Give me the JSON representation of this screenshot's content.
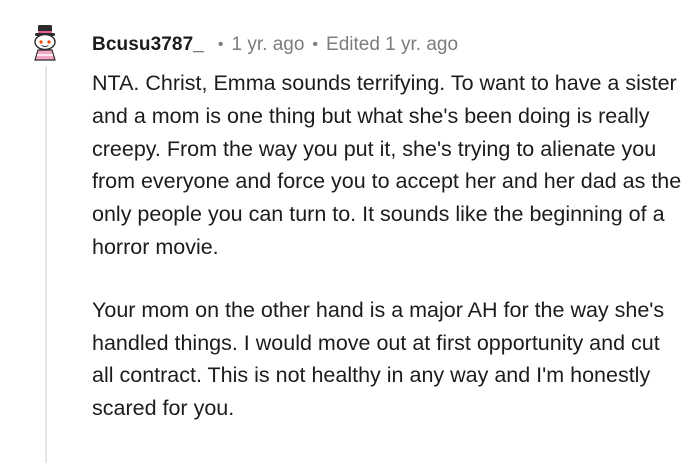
{
  "comment": {
    "username": "Bcusu3787_",
    "timestamp": "1 yr. ago",
    "edited": "Edited 1 yr. ago",
    "paragraphs": [
      "NTA. Christ, Emma sounds terrifying. To want to have a sister and a mom is one thing but what she's been doing is really creepy. From the way you put it, she's trying to alienate you from everyone and force you to accept her and her dad as the only people you can turn to. It sounds like the beginning of a horror movie.",
      "Your mom on the other hand is a major AH for the way she's handled things. I would move out at first opportunity and cut all contract. This is not healthy in any way and I'm honestly scared for you."
    ]
  },
  "separator": "•",
  "icons": {
    "avatar": "snoo-avatar-icon"
  },
  "colors": {
    "text": "#1c1c1c",
    "meta": "#7c7c7c",
    "thread_line": "#e6e6e6",
    "avatar_dress": "#f4a6c6"
  }
}
